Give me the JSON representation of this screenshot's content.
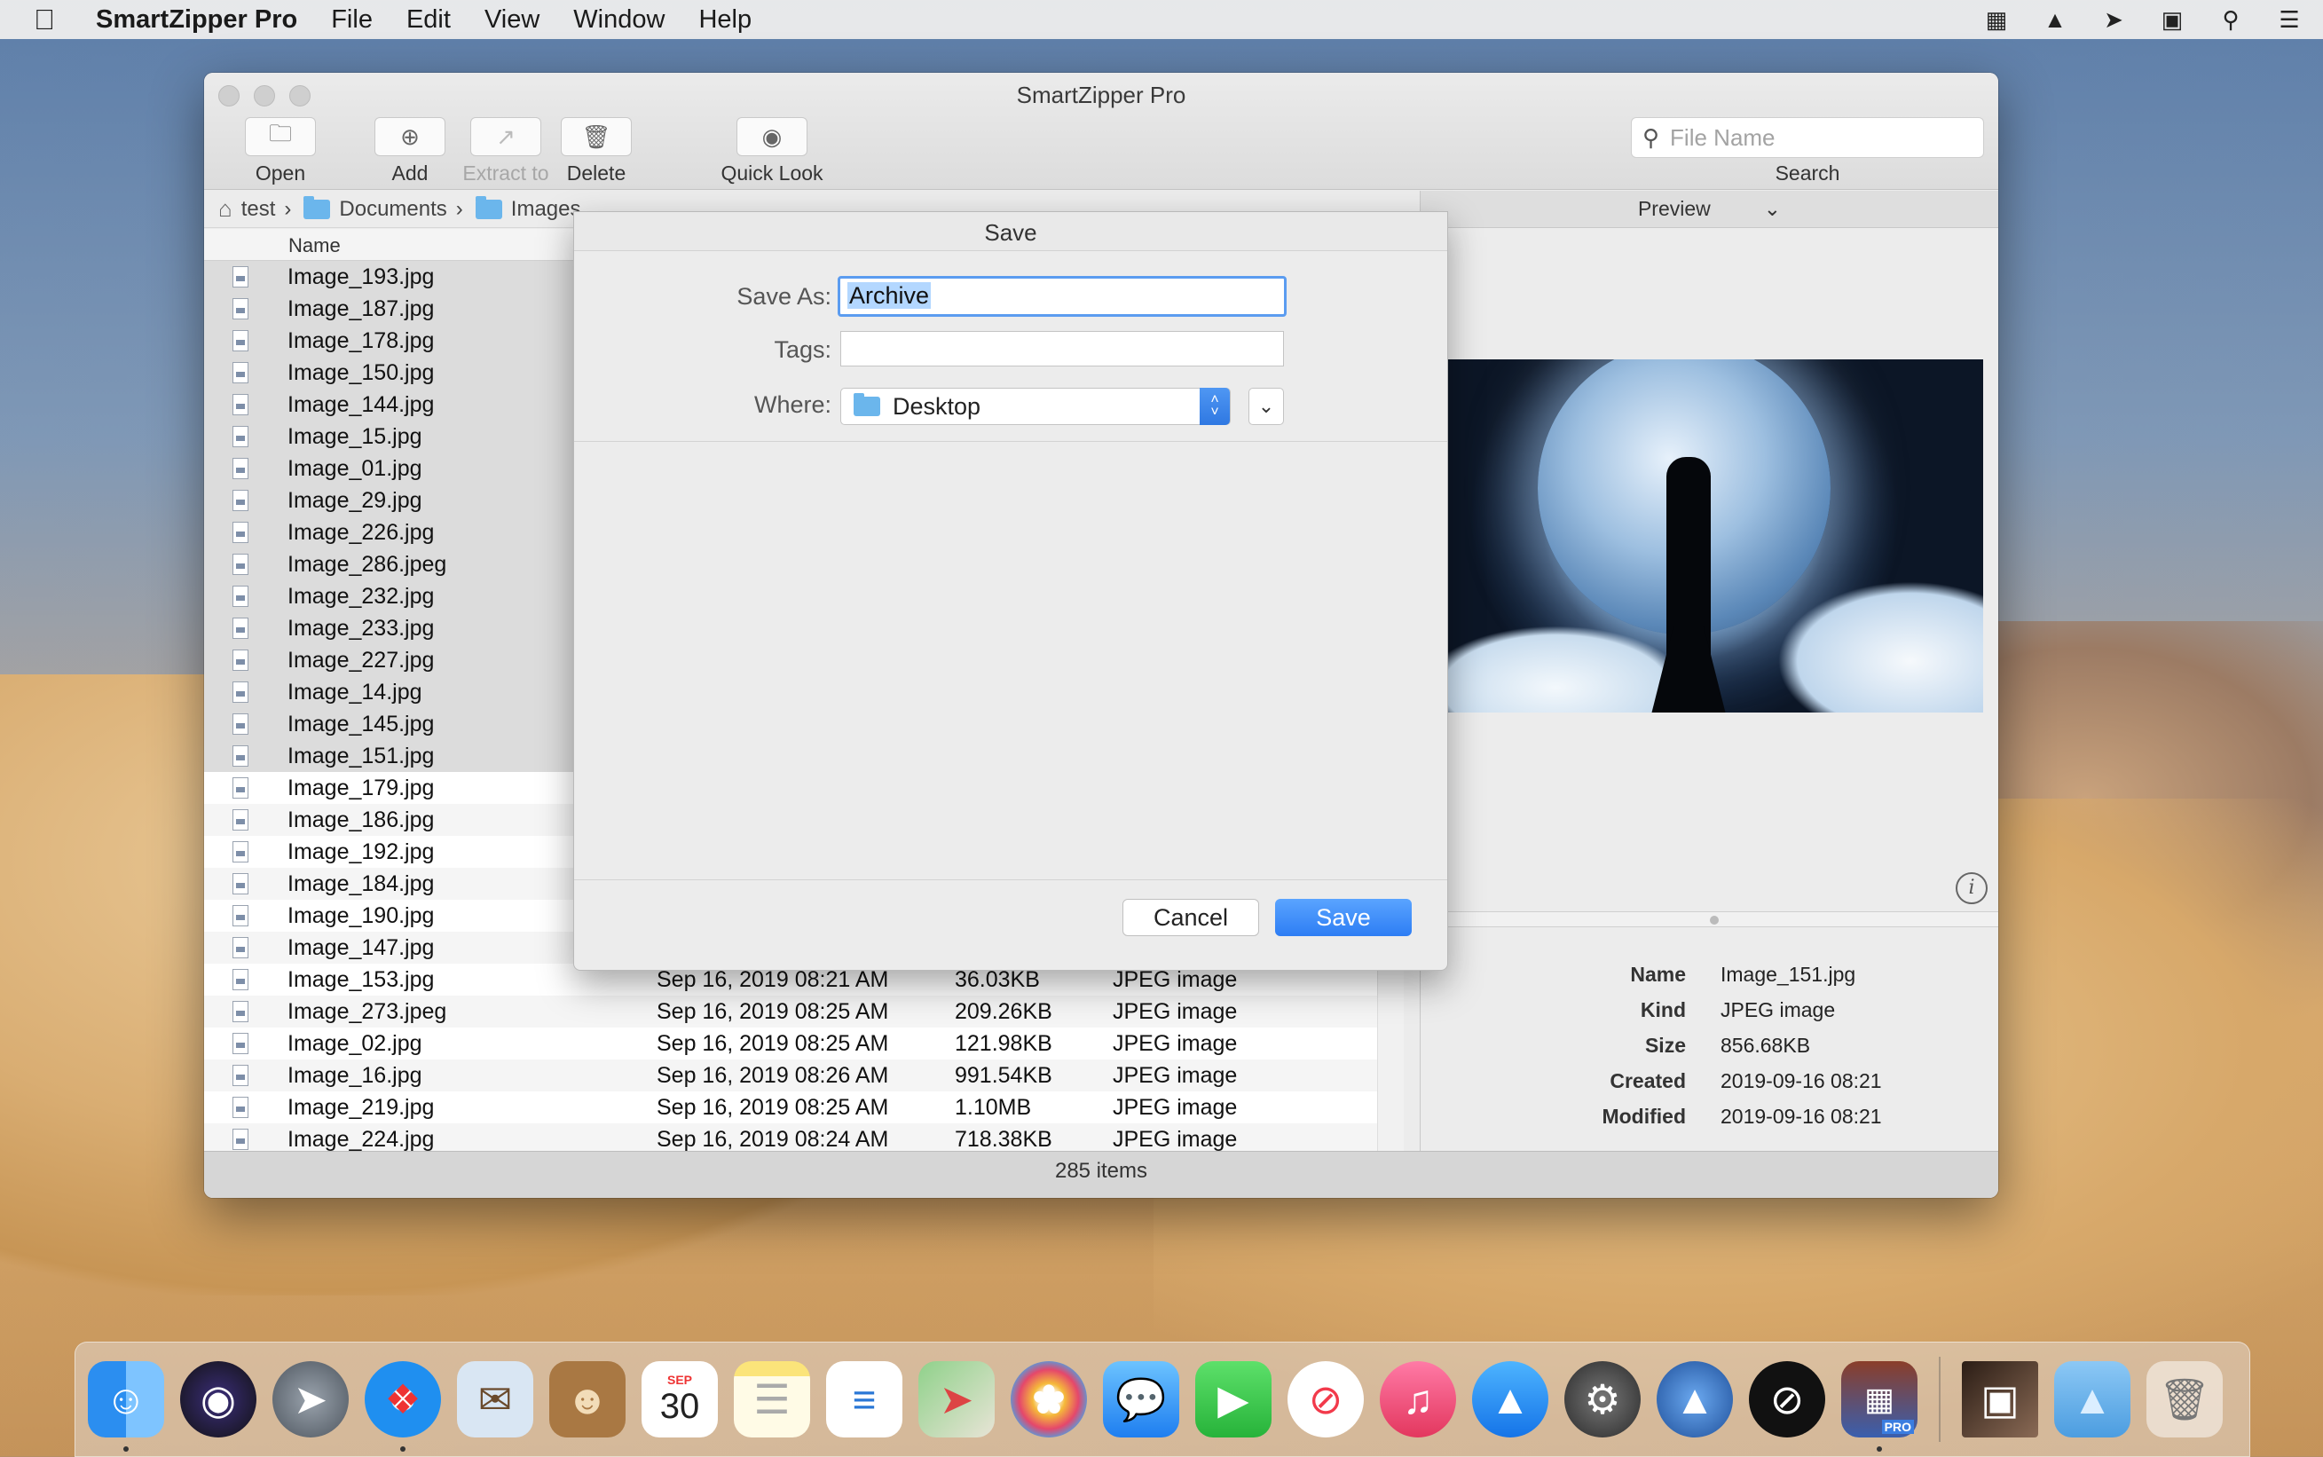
{
  "menubar": {
    "app_name": "SmartZipper Pro",
    "items": [
      "File",
      "Edit",
      "View",
      "Window",
      "Help"
    ]
  },
  "window": {
    "title": "SmartZipper Pro",
    "toolbar": {
      "open": "Open",
      "add": "Add",
      "extract": "Extract to",
      "delete": "Delete",
      "quicklook": "Quick Look",
      "search_placeholder": "File Name",
      "search_label": "Search"
    },
    "breadcrumb": [
      "test",
      "Documents",
      "Images"
    ],
    "column_name": "Name",
    "files": [
      {
        "name": "Image_193.jpg",
        "date": "",
        "size": "",
        "kind": ""
      },
      {
        "name": "Image_187.jpg",
        "date": "",
        "size": "",
        "kind": ""
      },
      {
        "name": "Image_178.jpg",
        "date": "",
        "size": "",
        "kind": ""
      },
      {
        "name": "Image_150.jpg",
        "date": "",
        "size": "",
        "kind": ""
      },
      {
        "name": "Image_144.jpg",
        "date": "",
        "size": "",
        "kind": ""
      },
      {
        "name": "Image_15.jpg",
        "date": "",
        "size": "",
        "kind": ""
      },
      {
        "name": "Image_01.jpg",
        "date": "",
        "size": "",
        "kind": ""
      },
      {
        "name": "Image_29.jpg",
        "date": "",
        "size": "",
        "kind": ""
      },
      {
        "name": "Image_226.jpg",
        "date": "",
        "size": "",
        "kind": ""
      },
      {
        "name": "Image_286.jpeg",
        "date": "",
        "size": "",
        "kind": ""
      },
      {
        "name": "Image_232.jpg",
        "date": "",
        "size": "",
        "kind": ""
      },
      {
        "name": "Image_233.jpg",
        "date": "",
        "size": "",
        "kind": ""
      },
      {
        "name": "Image_227.jpg",
        "date": "",
        "size": "",
        "kind": ""
      },
      {
        "name": "Image_14.jpg",
        "date": "",
        "size": "",
        "kind": ""
      },
      {
        "name": "Image_145.jpg",
        "date": "",
        "size": "",
        "kind": ""
      },
      {
        "name": "Image_151.jpg",
        "date": "",
        "size": "",
        "kind": ""
      },
      {
        "name": "Image_179.jpg",
        "date": "",
        "size": "",
        "kind": ""
      },
      {
        "name": "Image_186.jpg",
        "date": "",
        "size": "",
        "kind": ""
      },
      {
        "name": "Image_192.jpg",
        "date": "",
        "size": "",
        "kind": ""
      },
      {
        "name": "Image_184.jpg",
        "date": "",
        "size": "",
        "kind": ""
      },
      {
        "name": "Image_190.jpg",
        "date": "",
        "size": "",
        "kind": ""
      },
      {
        "name": "Image_147.jpg",
        "date": "",
        "size": "",
        "kind": ""
      },
      {
        "name": "Image_153.jpg",
        "date": "Sep 16, 2019 08:21 AM",
        "size": "36.03KB",
        "kind": "JPEG image"
      },
      {
        "name": "Image_273.jpeg",
        "date": "Sep 16, 2019 08:25 AM",
        "size": "209.26KB",
        "kind": "JPEG image"
      },
      {
        "name": "Image_02.jpg",
        "date": "Sep 16, 2019 08:25 AM",
        "size": "121.98KB",
        "kind": "JPEG image"
      },
      {
        "name": "Image_16.jpg",
        "date": "Sep 16, 2019 08:26 AM",
        "size": "991.54KB",
        "kind": "JPEG image"
      },
      {
        "name": "Image_219.jpg",
        "date": "Sep 16, 2019 08:25 AM",
        "size": "1.10MB",
        "kind": "JPEG image"
      },
      {
        "name": "Image_224.jpg",
        "date": "Sep 16, 2019 08:24 AM",
        "size": "718.38KB",
        "kind": "JPEG image"
      }
    ],
    "status": "285 items",
    "preview": {
      "header": "Preview",
      "info": [
        {
          "key": "Name",
          "value": "Image_151.jpg"
        },
        {
          "key": "Kind",
          "value": "JPEG image"
        },
        {
          "key": "Size",
          "value": "856.68KB"
        },
        {
          "key": "Created",
          "value": "2019-09-16 08:21"
        },
        {
          "key": "Modified",
          "value": "2019-09-16 08:21"
        }
      ]
    }
  },
  "dialog": {
    "title": "Save",
    "save_as_label": "Save As:",
    "save_as_value": "Archive",
    "tags_label": "Tags:",
    "tags_value": "",
    "where_label": "Where:",
    "where_value": "Desktop",
    "cancel": "Cancel",
    "save": "Save"
  },
  "dock": {
    "calendar_month": "SEP",
    "calendar_day": "30",
    "pro_badge": "PRO"
  }
}
